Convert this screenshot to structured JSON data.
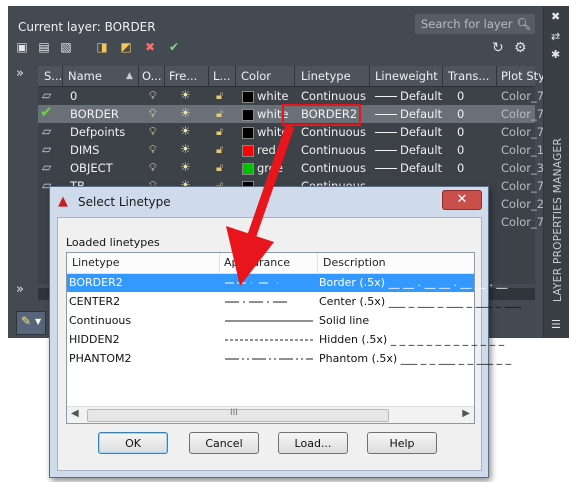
{
  "layer_manager": {
    "current_layer": "Current layer: BORDER",
    "search_placeholder": "Search for layer",
    "side_title": "LAYER PROPERTIES MANAGER",
    "columns": [
      "S...",
      "Name",
      "O...",
      "Fre...",
      "L...",
      "Color",
      "Linetype",
      "Lineweight",
      "Trans...",
      "Plot Styl"
    ],
    "rows": [
      {
        "name": "0",
        "color_name": "white",
        "color_hex": "#000000",
        "linetype": "Continuous",
        "lineweight": "Default",
        "trans": "0",
        "plot_style": "Color_7",
        "selected": false,
        "current": false
      },
      {
        "name": "BORDER",
        "color_name": "white",
        "color_hex": "#000000",
        "linetype": "BORDER2",
        "lineweight": "Default",
        "trans": "0",
        "plot_style": "Color_7",
        "selected": true,
        "current": true
      },
      {
        "name": "Defpoints",
        "color_name": "white",
        "color_hex": "#000000",
        "linetype": "Continuous",
        "lineweight": "Default",
        "trans": "0",
        "plot_style": "Color_7",
        "selected": false,
        "current": false
      },
      {
        "name": "DIMS",
        "color_name": "red",
        "color_hex": "#ff0000",
        "linetype": "Continuous",
        "lineweight": "Default",
        "trans": "0",
        "plot_style": "Color_1",
        "selected": false,
        "current": false
      },
      {
        "name": "OBJECT",
        "color_name": "gree",
        "color_hex": "#00c000",
        "linetype": "Continuous",
        "lineweight": "Default",
        "trans": "0",
        "plot_style": "Color_3",
        "selected": false,
        "current": false
      },
      {
        "name": "TB",
        "color_name": "",
        "color_hex": "#000000",
        "linetype": "Continuous",
        "lineweight": "",
        "trans": "",
        "plot_style": "Color_7",
        "selected": false,
        "current": false
      }
    ],
    "partial_plot_styles": [
      "Color_2",
      "Color_7"
    ]
  },
  "dialog": {
    "title": "Select Linetype",
    "loaded_label": "Loaded linetypes",
    "columns": [
      "Linetype",
      "Appearance",
      "Description"
    ],
    "linetypes": [
      {
        "name": "BORDER2",
        "description": "Border (.5x) __ __ . __ __ . __ __ . __",
        "selected": true
      },
      {
        "name": "CENTER2",
        "description": "Center (.5x) ___ _ ___ _ ___ _ ___ _ ___",
        "selected": false
      },
      {
        "name": "Continuous",
        "description": "Solid line",
        "selected": false
      },
      {
        "name": "HIDDEN2",
        "description": "Hidden (.5x) _ _ _ _ _ _ _ _ _ _ _ _ _",
        "selected": false
      },
      {
        "name": "PHANTOM2",
        "description": "Phantom (.5x) ___ _ _ ___ _ _ ___ _ _",
        "selected": false
      }
    ],
    "scroll_mark": "III",
    "buttons": {
      "ok": "OK",
      "cancel": "Cancel",
      "load": "Load...",
      "help": "Help"
    }
  },
  "colors": {
    "highlight": "#e8161c",
    "selection": "#3399ff",
    "panel": "#444a52"
  }
}
